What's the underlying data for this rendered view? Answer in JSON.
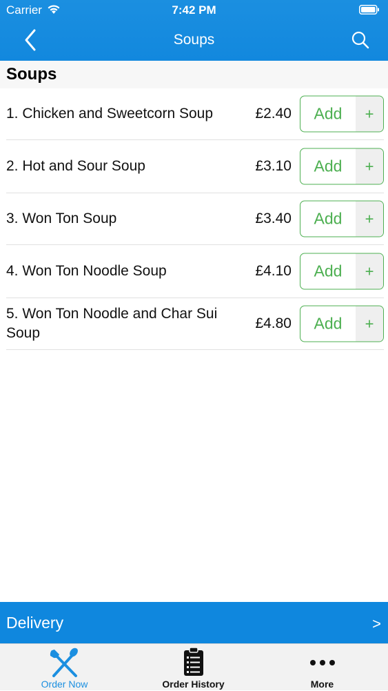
{
  "status_bar": {
    "carrier": "Carrier",
    "time": "7:42 PM"
  },
  "nav": {
    "title": "Soups"
  },
  "section": {
    "title": "Soups"
  },
  "items": [
    {
      "name": "1. Chicken and Sweetcorn Soup",
      "price": "£2.40",
      "add_label": "Add",
      "plus": "+"
    },
    {
      "name": "2. Hot and Sour Soup",
      "price": "£3.10",
      "add_label": "Add",
      "plus": "+"
    },
    {
      "name": "3. Won Ton Soup",
      "price": "£3.40",
      "add_label": "Add",
      "plus": "+"
    },
    {
      "name": "4. Won Ton Noodle Soup",
      "price": "£4.10",
      "add_label": "Add",
      "plus": "+"
    },
    {
      "name": "5. Won Ton Noodle and Char Sui Soup",
      "price": "£4.80",
      "add_label": "Add",
      "plus": "+"
    }
  ],
  "delivery": {
    "label": "Delivery",
    "chevron": ">"
  },
  "tabs": [
    {
      "label": "Order Now",
      "icon": "fork-knife-icon",
      "active": true
    },
    {
      "label": "Order History",
      "icon": "clipboard-list-icon",
      "active": false
    },
    {
      "label": "More",
      "icon": "more-dots-icon",
      "active": false
    }
  ],
  "colors": {
    "brand_blue": "#1288de",
    "add_green": "#4caf50"
  }
}
